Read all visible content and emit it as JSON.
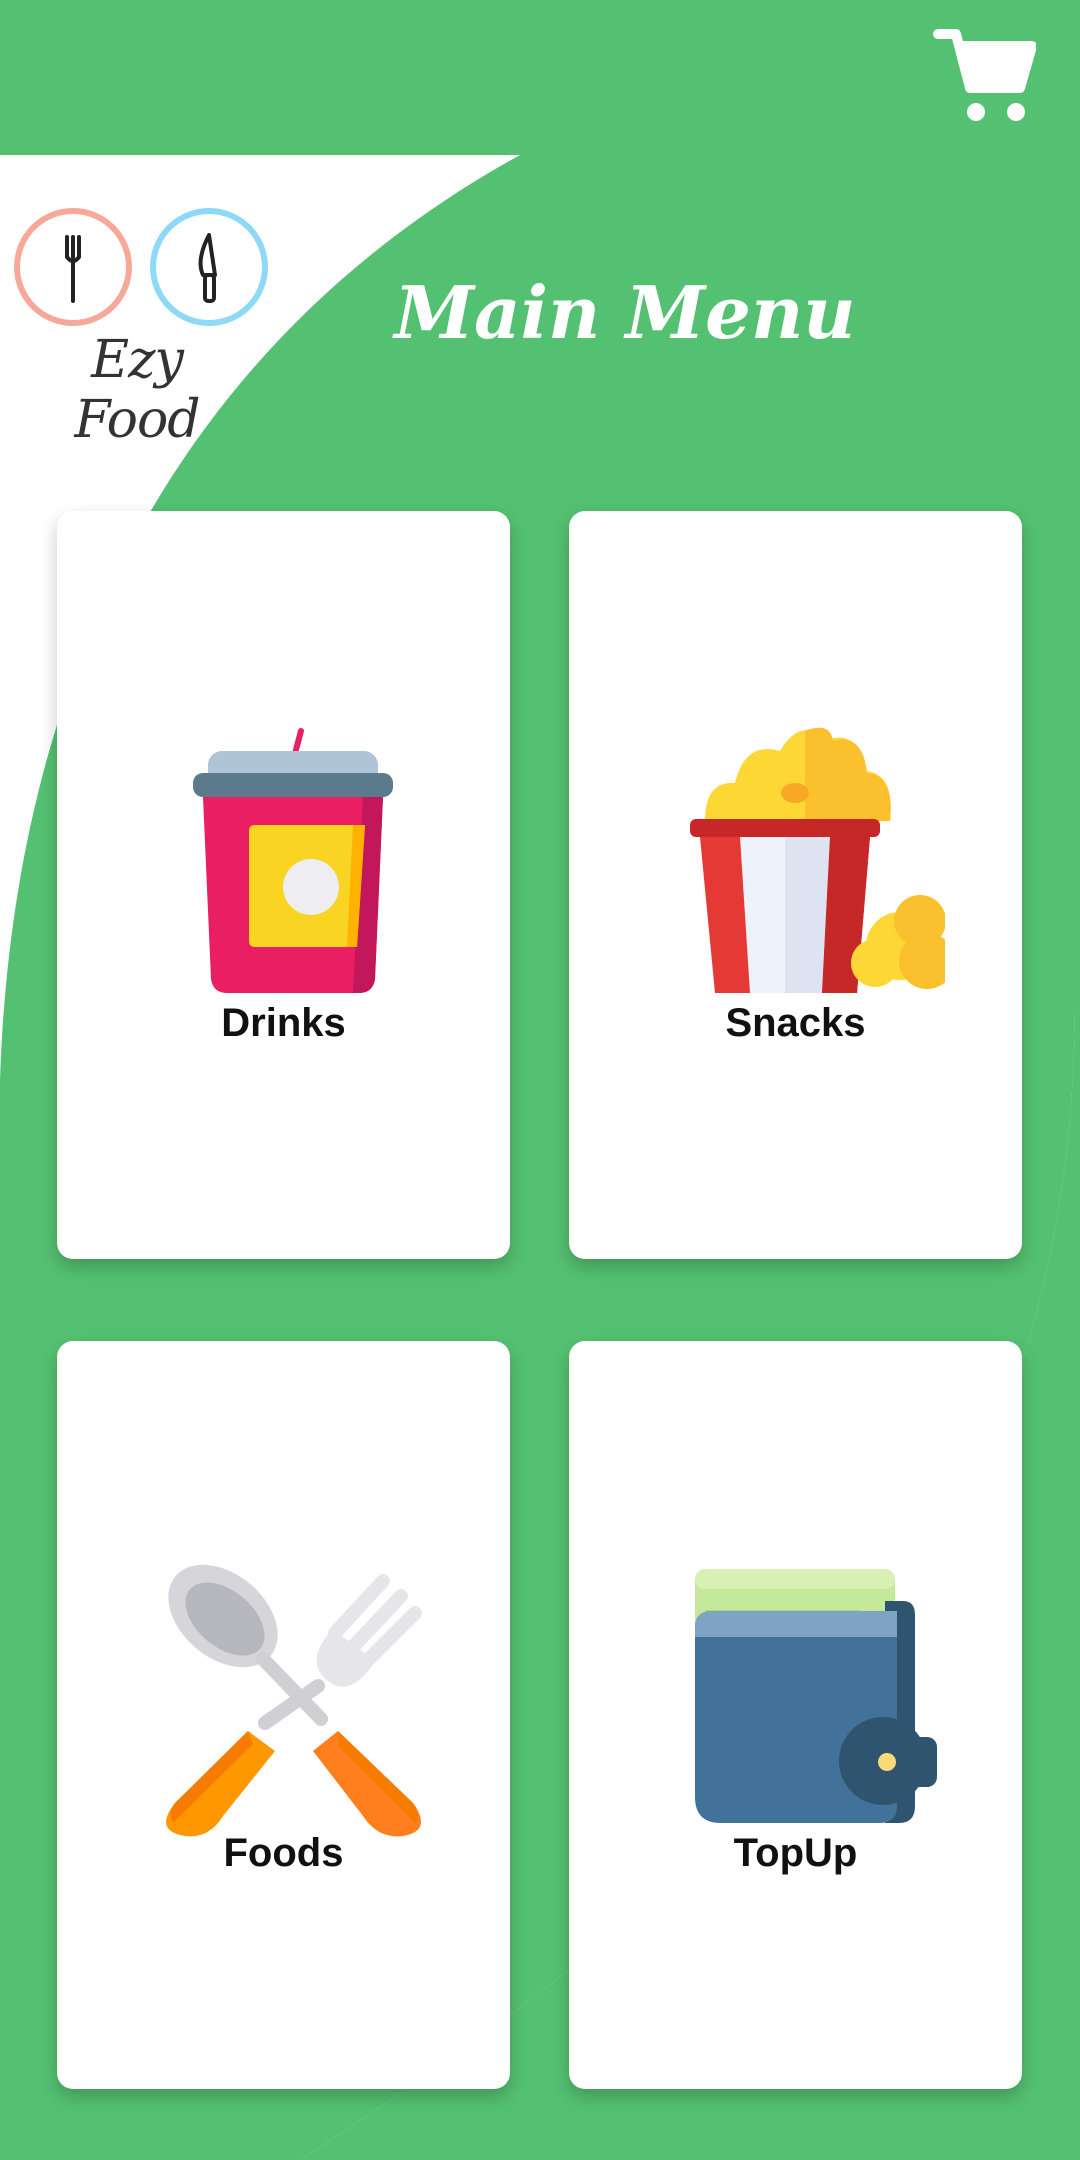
{
  "colors": {
    "primary_green": "#54C172",
    "white": "#FFFFFF",
    "logo_ring_left": "#F7A999",
    "logo_ring_right": "#8ED9F7"
  },
  "header": {
    "cart_icon": "shopping-cart-icon"
  },
  "logo": {
    "text": "Ezy Food",
    "icons": [
      "fork-icon",
      "knife-icon"
    ]
  },
  "page": {
    "title": "Main Menu"
  },
  "menu": {
    "items": [
      {
        "label": "Drinks",
        "icon": "drink-cup-icon"
      },
      {
        "label": "Snacks",
        "icon": "popcorn-icon"
      },
      {
        "label": "Foods",
        "icon": "spoon-fork-icon"
      },
      {
        "label": "TopUp",
        "icon": "wallet-icon"
      }
    ]
  }
}
